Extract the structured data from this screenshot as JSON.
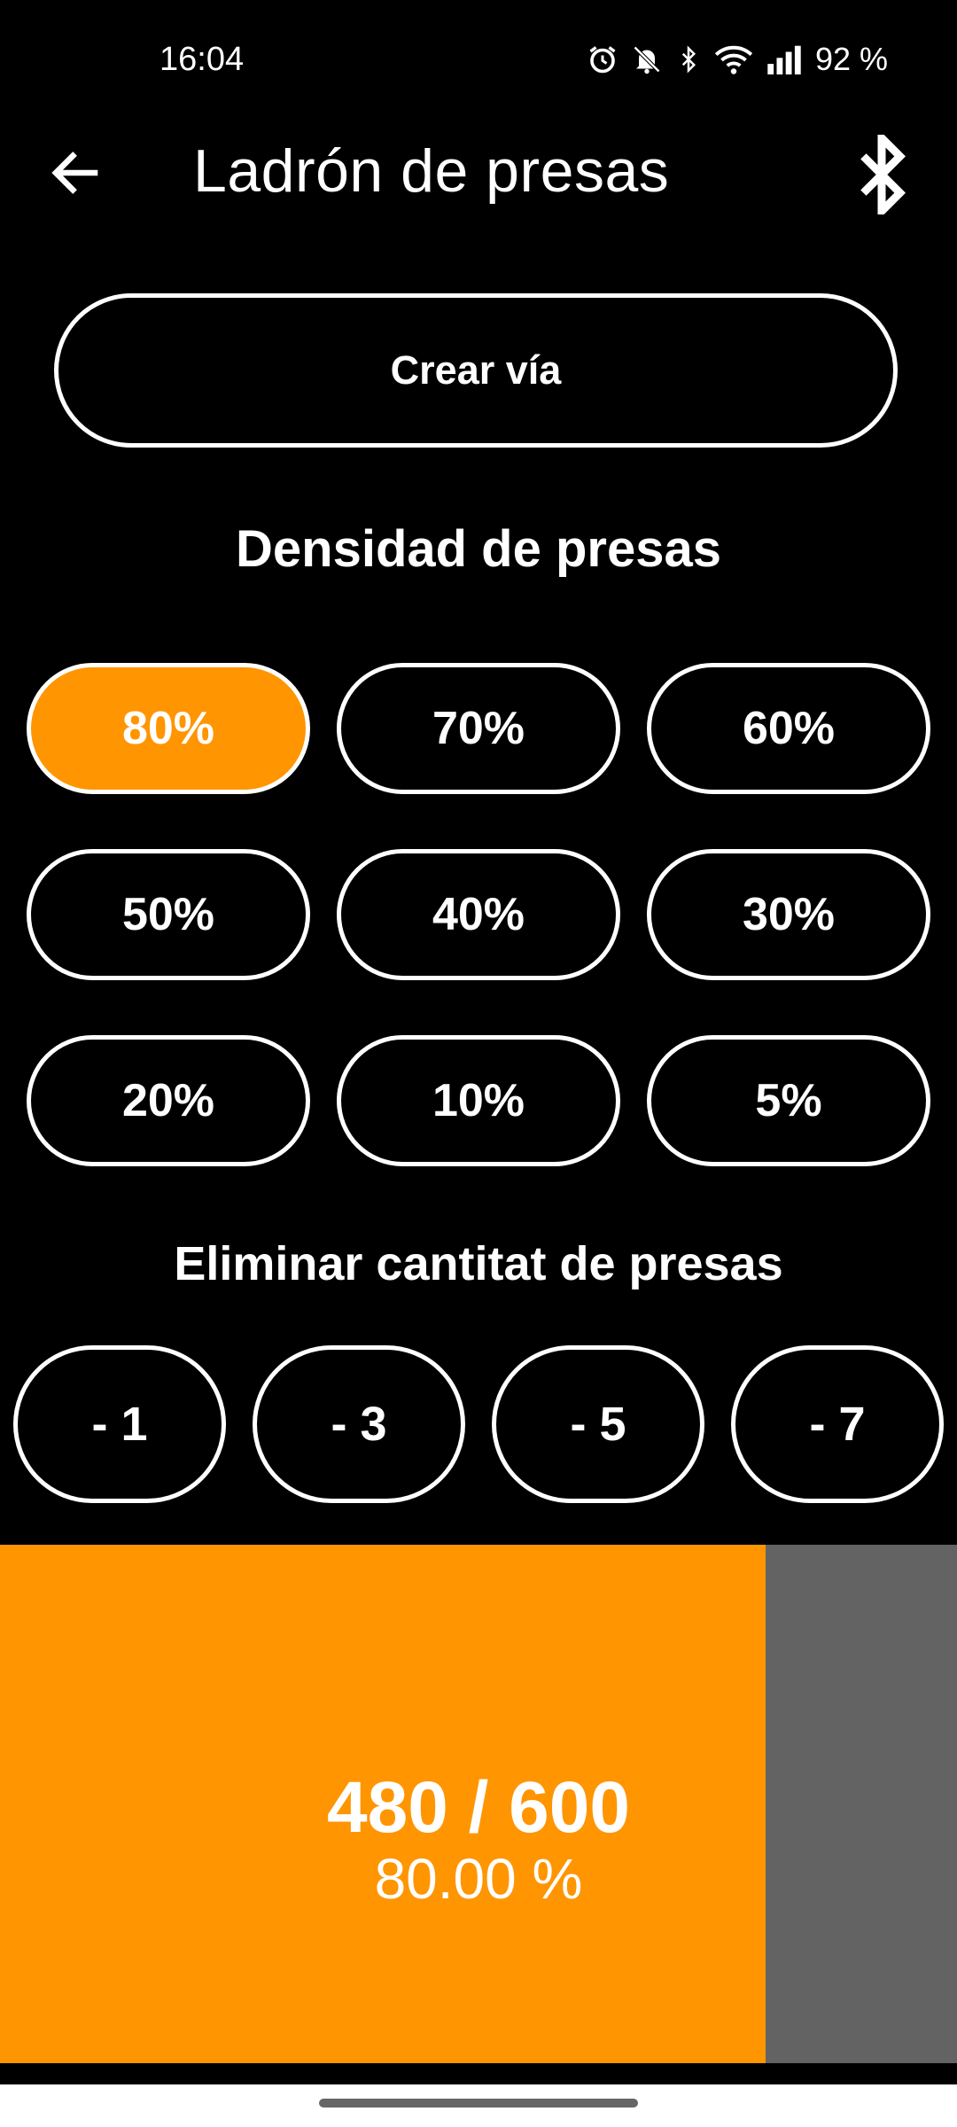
{
  "status": {
    "time": "16:04",
    "battery": "92 %"
  },
  "header": {
    "title": "Ladrón de presas"
  },
  "create_route": {
    "label": "Crear vía"
  },
  "density": {
    "title": "Densidad de presas",
    "options": [
      "80%",
      "70%",
      "60%",
      "50%",
      "40%",
      "30%",
      "20%",
      "10%",
      "5%"
    ],
    "selected": "80%"
  },
  "remove": {
    "title": "Eliminar cantitat de presas",
    "options": [
      "- 1",
      "- 3",
      "- 5",
      "- 7"
    ]
  },
  "progress": {
    "count": "480 / 600",
    "percent": "80.00 %",
    "fraction": 0.8
  },
  "colors": {
    "accent": "#ff9500",
    "background": "#000000",
    "track": "#636363",
    "text": "#ffffff"
  },
  "icons": {
    "back": "arrow-left-icon",
    "bluetooth": "bluetooth-icon"
  }
}
